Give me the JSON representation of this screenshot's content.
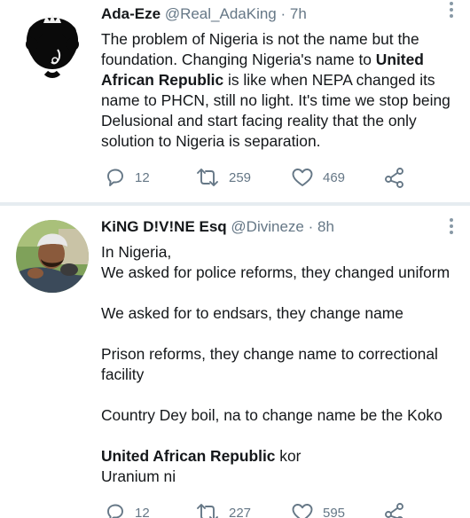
{
  "tweets": [
    {
      "name": "Ada-Eze",
      "handle": "@Real_AdaKing",
      "separator": "·",
      "time": "7h",
      "lines": [
        {
          "parts": [
            {
              "text": "The problem of Nigeria is not the name but the",
              "bold": false
            }
          ]
        },
        {
          "parts": [
            {
              "text": "foundation. Changing Nigeria's name to ",
              "bold": false
            },
            {
              "text": "United",
              "bold": true
            }
          ]
        },
        {
          "parts": [
            {
              "text": "African Republic",
              "bold": true
            },
            {
              "text": " is like when NEPA changed its",
              "bold": false
            }
          ]
        },
        {
          "parts": [
            {
              "text": "name to PHCN, still no light. It's time we stop being",
              "bold": false
            }
          ]
        },
        {
          "parts": [
            {
              "text": "Delusional and start facing reality that the only",
              "bold": false
            }
          ]
        },
        {
          "parts": [
            {
              "text": "solution to Nigeria is separation.",
              "bold": false
            }
          ]
        }
      ],
      "replies": "12",
      "retweets": "259",
      "likes": "469"
    },
    {
      "name": "KiNG D!V!NE Esq",
      "handle": "@Divineze",
      "separator": "·",
      "time": "8h",
      "lines": [
        {
          "parts": [
            {
              "text": "In Nigeria,",
              "bold": false
            }
          ]
        },
        {
          "parts": [
            {
              "text": "We asked for police reforms, they changed uniform",
              "bold": false
            }
          ]
        },
        {
          "parts": []
        },
        {
          "parts": [
            {
              "text": "We asked for to endsars, they change name",
              "bold": false
            }
          ]
        },
        {
          "parts": []
        },
        {
          "parts": [
            {
              "text": "Prison reforms, they change name to correctional",
              "bold": false
            }
          ]
        },
        {
          "parts": [
            {
              "text": "facility",
              "bold": false
            }
          ]
        },
        {
          "parts": []
        },
        {
          "parts": [
            {
              "text": "Country Dey boil, na to change name be the Koko",
              "bold": false
            }
          ]
        },
        {
          "parts": []
        },
        {
          "parts": [
            {
              "text": "United African Republic",
              "bold": true
            },
            {
              "text": " kor",
              "bold": false
            }
          ]
        },
        {
          "parts": [
            {
              "text": "Uranium ni",
              "bold": false
            }
          ]
        }
      ],
      "replies": "12",
      "retweets": "227",
      "likes": "595"
    }
  ],
  "icons": {
    "reply": "reply-icon",
    "retweet": "retweet-icon",
    "like": "like-icon",
    "share": "share-icon",
    "more": "more-options-icon"
  },
  "colors": {
    "text": "#14171a",
    "secondary": "#657786",
    "divider": "#e6ecf0"
  }
}
